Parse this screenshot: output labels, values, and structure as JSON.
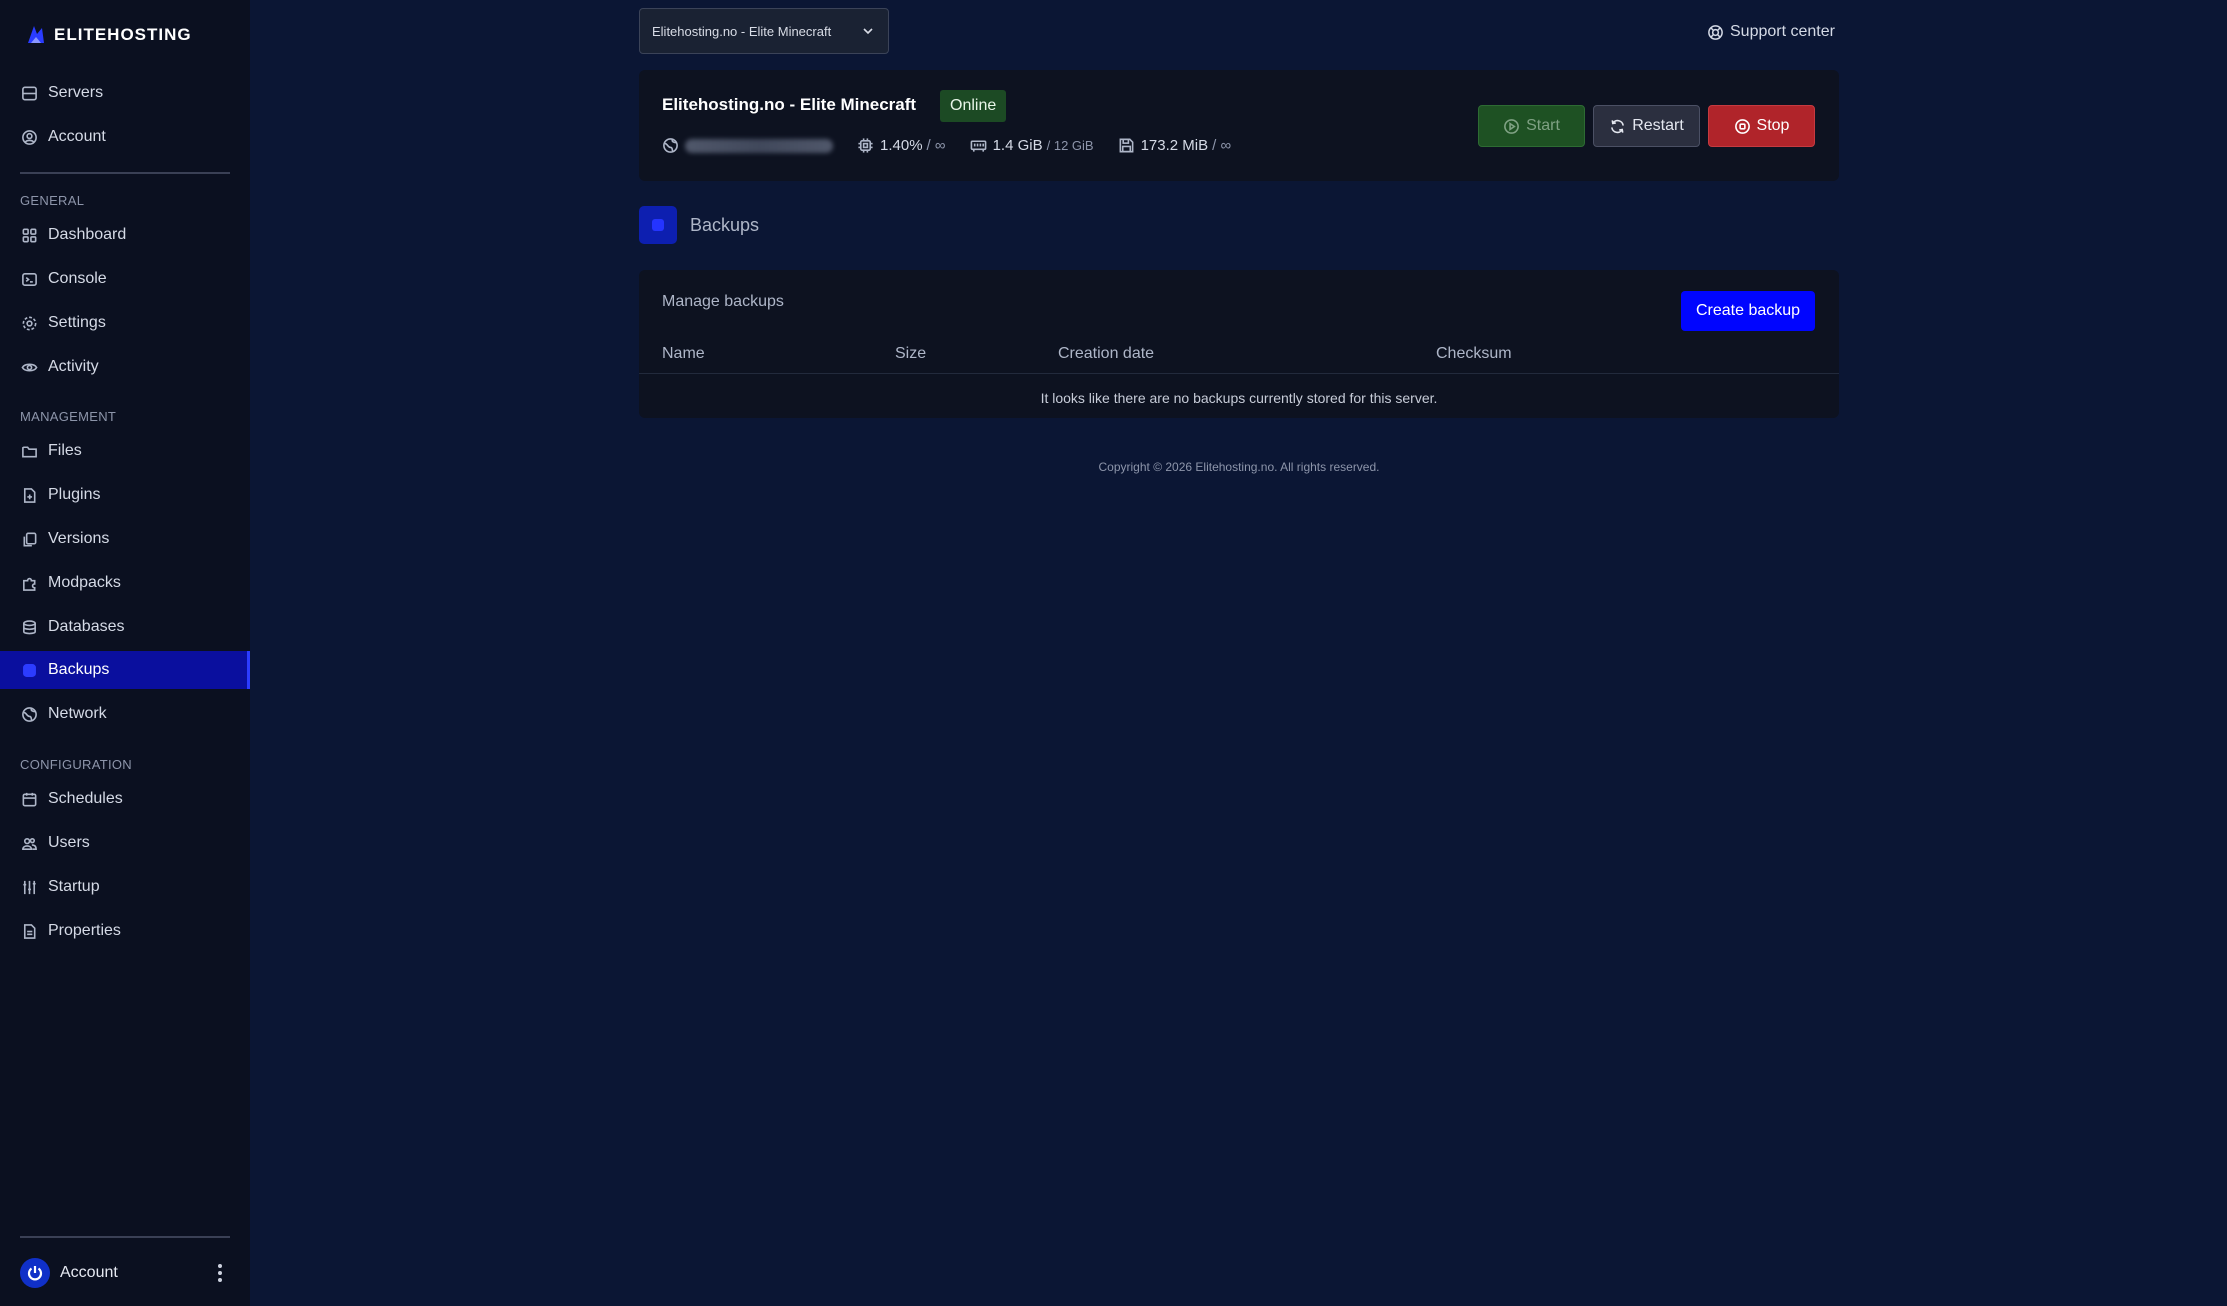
{
  "sidebar": {
    "brand": "ELITEHOSTING",
    "top_items": [
      {
        "label": "Servers",
        "icon": "server-icon"
      },
      {
        "label": "Account",
        "icon": "user-circle-icon"
      }
    ],
    "sections": {
      "general": "GENERAL",
      "management": "MANAGEMENT",
      "configuration": "CONFIGURATION"
    },
    "items": [
      {
        "label": "Dashboard"
      },
      {
        "label": "Console"
      },
      {
        "label": "Settings"
      },
      {
        "label": "Activity"
      },
      {
        "label": "Files"
      },
      {
        "label": "Plugins"
      },
      {
        "label": "Versions"
      },
      {
        "label": "Modpacks"
      },
      {
        "label": "Databases"
      },
      {
        "label": "Backups",
        "active": true
      },
      {
        "label": "Network"
      },
      {
        "label": "Schedules"
      },
      {
        "label": "Users"
      },
      {
        "label": "Startup"
      },
      {
        "label": "Properties"
      }
    ],
    "account_label": "Account"
  },
  "topbar": {
    "server_select": "Elitehosting.no - Elite Minecraft",
    "support": "Support center"
  },
  "server": {
    "name": "Elitehosting.no - Elite Minecraft",
    "status": "Online",
    "cpu": "1.40%",
    "cpu_limit": "/ ∞",
    "memory": "1.4 GiB",
    "memory_limit": "/ 12 GiB",
    "disk": "173.2 MiB",
    "disk_limit": "/ ∞",
    "buttons": {
      "start": "Start",
      "restart": "Restart",
      "stop": "Stop"
    }
  },
  "page": {
    "title": "Backups"
  },
  "backups": {
    "title": "Manage backups",
    "create_button": "Create backup",
    "columns": [
      "Name",
      "Size",
      "Creation date",
      "Checksum"
    ],
    "empty_message": "It looks like there are no backups currently stored for this server."
  },
  "footer": {
    "copyright": "Copyright © 2026 Elitehosting.no. All rights reserved."
  },
  "colors": {
    "background": "#0b1634",
    "sidebar": "#0b1020",
    "active_nav": "#0a0f9e",
    "primary": "#0005ff",
    "online": "#1c4a24",
    "stop": "#b0242a"
  }
}
